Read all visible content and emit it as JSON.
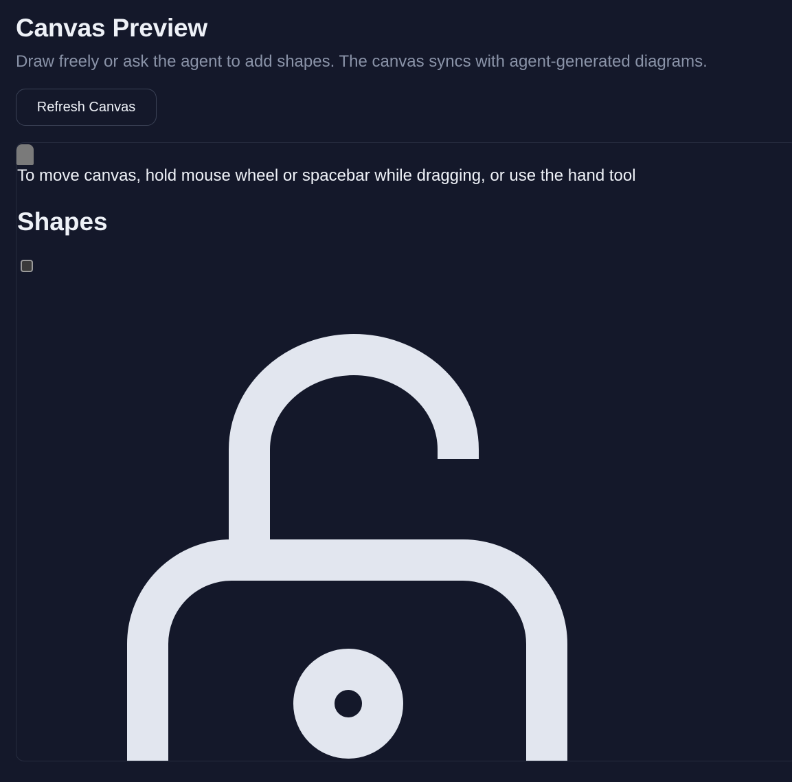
{
  "header": {
    "title": "Canvas Preview",
    "subtitle": "Draw freely or ask the agent to add shapes. The canvas syncs with agent-generated diagrams."
  },
  "toolbar": {
    "refresh_label": "Refresh Canvas"
  },
  "canvas": {
    "hint": "To move canvas, hold mouse wheel or spacebar while dragging, or use the hand tool",
    "shapes_heading": "Shapes",
    "shape_checkbox_checked": false,
    "icon": "unlock-icon",
    "icon_color": "#e2e6ef"
  },
  "colors": {
    "background": "#14182a",
    "text": "#eef1f7",
    "muted_text": "#8a93a8",
    "border": "#3b4256"
  }
}
